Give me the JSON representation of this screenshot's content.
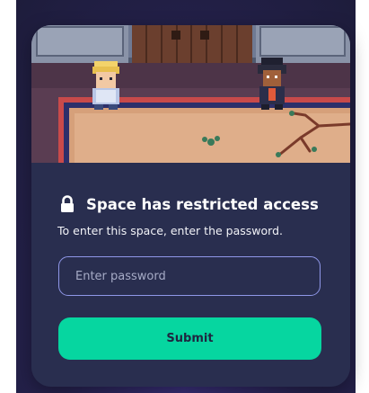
{
  "dialog": {
    "title": "Space has restricted access",
    "subtitle": "To enter this space, enter the password.",
    "password": {
      "value": "",
      "placeholder": "Enter password"
    },
    "submit_label": "Submit"
  },
  "colors": {
    "backdrop": "#26224f",
    "panel": "#292e4f",
    "input_border": "#8f97e8",
    "submit_bg": "#06d6a0",
    "submit_text": "#1f2540"
  },
  "icons": {
    "title_icon": "lock-icon"
  }
}
